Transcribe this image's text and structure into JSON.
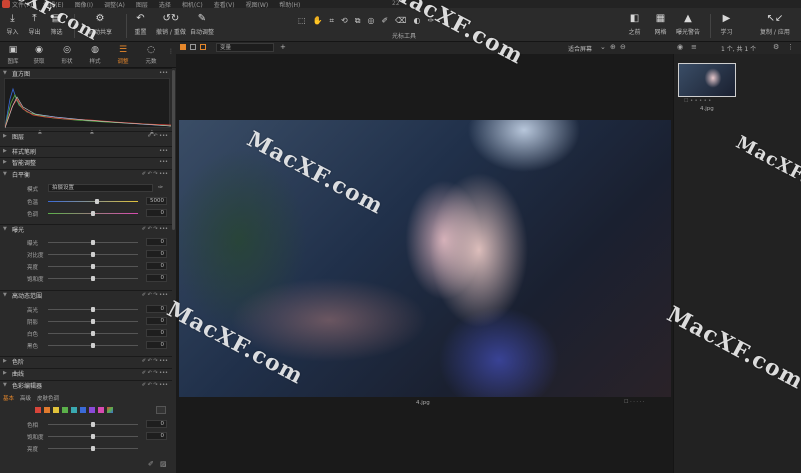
{
  "menubar": {
    "items": [
      "文件(F)",
      "编辑(E)",
      "图像(I)",
      "调整(A)",
      "图层",
      "选择",
      "相机(C)",
      "查看(V)",
      "视图(W)",
      "帮助(H)"
    ],
    "title": "22"
  },
  "toolbar": {
    "left_buttons": [
      {
        "label": "导入",
        "icon": "import-icon"
      },
      {
        "label": "导出",
        "icon": "export-icon"
      },
      {
        "label": "筛选",
        "icon": "filter-icon"
      },
      {
        "label": "自动共享",
        "icon": "share-icon"
      },
      {
        "label": "重置",
        "icon": "reset-icon"
      },
      {
        "label": "撤销 / 重做",
        "icon": "undo-redo-icon"
      },
      {
        "label": "自动调整",
        "icon": "auto-adjust-icon"
      }
    ],
    "cursor_tools_label": "光标工具",
    "right_buttons": [
      {
        "label": "之前",
        "icon": "before-icon"
      },
      {
        "label": "网格",
        "icon": "grid-icon"
      },
      {
        "label": "曝光警告",
        "icon": "warning-icon"
      },
      {
        "label": "学习",
        "icon": "learn-icon"
      },
      {
        "label": "复制 / 应用",
        "icon": "copy-apply-icon"
      }
    ]
  },
  "tool_tabs": [
    {
      "label": "图库",
      "icon": "library-icon",
      "active": false
    },
    {
      "label": "获取",
      "icon": "capture-icon",
      "active": false
    },
    {
      "label": "形状",
      "icon": "shape-icon",
      "active": false
    },
    {
      "label": "样式",
      "icon": "style-icon",
      "active": false
    },
    {
      "label": "调整",
      "icon": "adjust-icon",
      "active": true
    },
    {
      "label": "元数",
      "icon": "meta-icon",
      "active": false
    }
  ],
  "left_panel": {
    "sections": {
      "histogram": "直方图",
      "layers": "图层",
      "style_brushes": "样式笔刷",
      "smart_adjust": "智能调整",
      "white_balance": "白平衡",
      "exposure": "曝光",
      "hdr": "高动态范围",
      "levels": "色阶",
      "curve": "曲线",
      "color_editor": "色彩编辑器"
    },
    "white_balance": {
      "mode_label": "模式",
      "mode_value": "拍摄设置",
      "rows": [
        {
          "label": "色温",
          "value": "5000"
        },
        {
          "label": "色调",
          "value": "0"
        }
      ]
    },
    "exposure_rows": [
      {
        "label": "曝光",
        "value": "0"
      },
      {
        "label": "对比度",
        "value": "0"
      },
      {
        "label": "亮度",
        "value": "0"
      },
      {
        "label": "饱和度",
        "value": "0"
      }
    ],
    "hdr_rows": [
      {
        "label": "高光",
        "value": "0"
      },
      {
        "label": "阴影",
        "value": "0"
      },
      {
        "label": "白色",
        "value": "0"
      },
      {
        "label": "黑色",
        "value": "0"
      }
    ],
    "color_editor": {
      "tabs": [
        "基本",
        "高级",
        "皮肤色调"
      ],
      "swatches": [
        "#d8453a",
        "#e07a2e",
        "#e0c23a",
        "#5bb04a",
        "#3aa9b0",
        "#3a6ad8",
        "#8a4ad8",
        "#d84ab0"
      ],
      "rows": [
        {
          "label": "色相",
          "value": "0"
        },
        {
          "label": "饱和度",
          "value": "0"
        },
        {
          "label": "亮度",
          "value": ""
        }
      ]
    }
  },
  "viewer": {
    "zoom_label": "适合屏幕",
    "count_label": "1 个, 共 1 个",
    "variant_select": "变量",
    "photo_name": "4.jpg"
  },
  "browser": {
    "thumb_name": "4.jpg"
  },
  "watermarks": [
    "MacXF.com",
    "MacXF.com",
    "MacXF.com",
    "MacXF.com",
    "MacXF.com",
    "MacXF.com"
  ],
  "colors": {
    "accent": "#e5872b",
    "panel": "#2a2a2a",
    "background": "#1a1a1a"
  }
}
